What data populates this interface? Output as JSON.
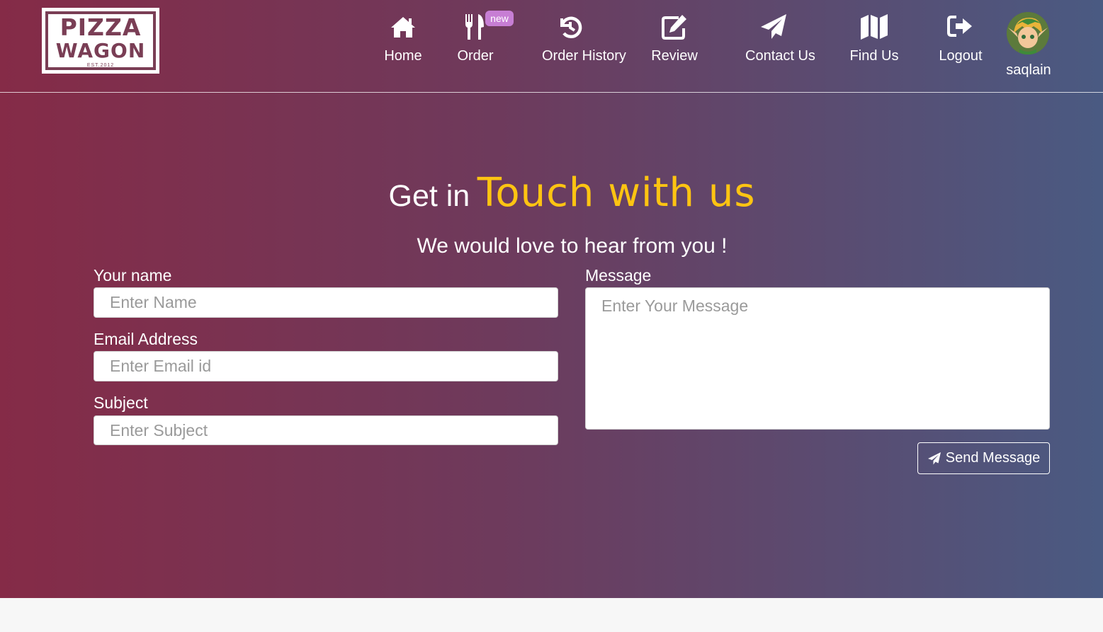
{
  "brand": {
    "logo_line1": "PIZZA",
    "logo_line2": "WAGON",
    "logo_est": "EST.2012"
  },
  "nav": {
    "items": [
      {
        "label": "Home",
        "icon": "home-icon"
      },
      {
        "label": "Order",
        "icon": "utensils-icon",
        "badge": "new"
      },
      {
        "label": "Order History",
        "icon": "history-icon"
      },
      {
        "label": "Review",
        "icon": "edit-icon"
      },
      {
        "label": "Contact Us",
        "icon": "paper-plane-icon"
      },
      {
        "label": "Find Us",
        "icon": "map-icon"
      },
      {
        "label": "Logout",
        "icon": "logout-icon"
      }
    ],
    "username": "saqlain"
  },
  "contact": {
    "heading_plain": "Get in",
    "heading_accent": "Touch with us",
    "subheading": "We would love to hear from you !",
    "name_label": "Your name",
    "name_placeholder": "Enter Name",
    "email_label": "Email Address",
    "email_placeholder": "Enter Email id",
    "subject_label": "Subject",
    "subject_placeholder": "Enter Subject",
    "message_label": "Message",
    "message_placeholder": "Enter Your Message",
    "send_label": "Send Message"
  },
  "colors": {
    "gradient_start": "#852b47",
    "gradient_end": "#4a5a82",
    "accent": "#fec412",
    "badge": "#c77ed4"
  }
}
